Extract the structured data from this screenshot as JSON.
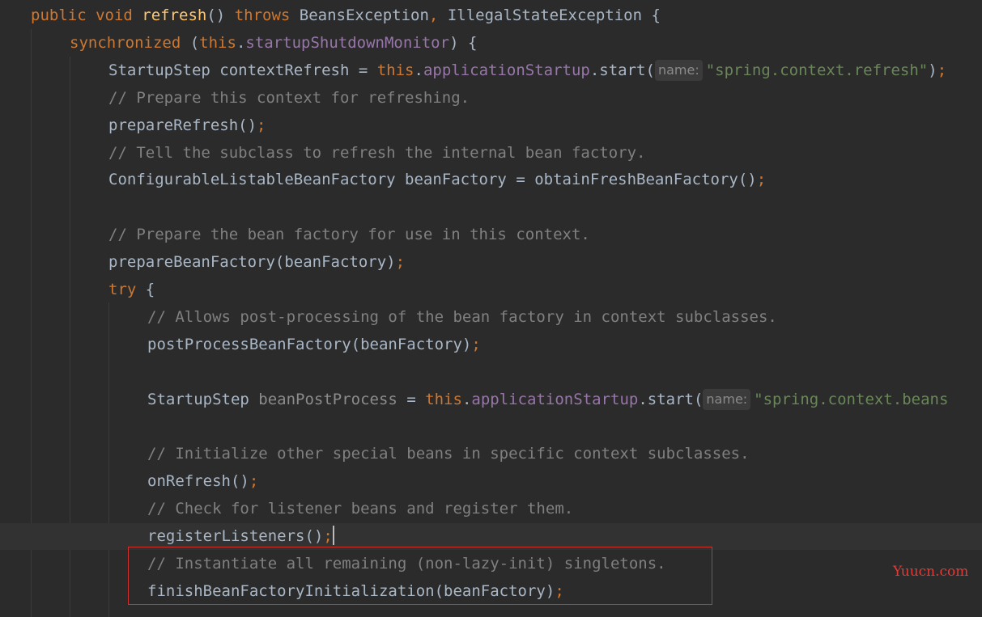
{
  "editor": {
    "lines": [
      {
        "indent": 38,
        "tokens": [
          {
            "t": "public ",
            "c": "kw"
          },
          {
            "t": "void ",
            "c": "kw"
          },
          {
            "t": "refresh",
            "c": "fn"
          },
          {
            "t": "() ",
            "c": "punc"
          },
          {
            "t": "throws ",
            "c": "kw"
          },
          {
            "t": "BeansException",
            "c": "cls"
          },
          {
            "t": ", ",
            "c": "semi"
          },
          {
            "t": "IllegalStateException ",
            "c": "cls"
          },
          {
            "t": "{",
            "c": "punc"
          }
        ]
      },
      {
        "indent": 86,
        "tokens": [
          {
            "t": "synchronized ",
            "c": "kw"
          },
          {
            "t": "(",
            "c": "punc"
          },
          {
            "t": "this",
            "c": "kw"
          },
          {
            "t": ".",
            "c": "punc"
          },
          {
            "t": "startupShutdownMonitor",
            "c": "fld"
          },
          {
            "t": ") {",
            "c": "punc"
          }
        ]
      },
      {
        "indent": 134,
        "tokens": [
          {
            "t": "StartupStep contextRefresh = ",
            "c": "cls"
          },
          {
            "t": "this",
            "c": "kw"
          },
          {
            "t": ".",
            "c": "punc"
          },
          {
            "t": "applicationStartup",
            "c": "fld"
          },
          {
            "t": ".start(",
            "c": "punc"
          },
          {
            "t": "name:",
            "c": "hint"
          },
          {
            "t": "\"spring.context.refresh\"",
            "c": "str"
          },
          {
            "t": ")",
            "c": "punc"
          },
          {
            "t": ";",
            "c": "semi"
          }
        ]
      },
      {
        "indent": 134,
        "tokens": [
          {
            "t": "// Prepare this context for refreshing.",
            "c": "cm"
          }
        ]
      },
      {
        "indent": 134,
        "tokens": [
          {
            "t": "prepareRefresh()",
            "c": "punc"
          },
          {
            "t": ";",
            "c": "semi"
          }
        ]
      },
      {
        "indent": 134,
        "tokens": [
          {
            "t": "// Tell the subclass to refresh the internal bean factory.",
            "c": "cm"
          }
        ]
      },
      {
        "indent": 134,
        "tokens": [
          {
            "t": "ConfigurableListableBeanFactory beanFactory = obtainFreshBeanFactory()",
            "c": "punc"
          },
          {
            "t": ";",
            "c": "semi"
          }
        ]
      },
      {
        "indent": 134,
        "tokens": []
      },
      {
        "indent": 134,
        "tokens": [
          {
            "t": "// Prepare the bean factory for use in this context.",
            "c": "cm"
          }
        ]
      },
      {
        "indent": 134,
        "tokens": [
          {
            "t": "prepareBeanFactory(beanFactory)",
            "c": "punc"
          },
          {
            "t": ";",
            "c": "semi"
          }
        ]
      },
      {
        "indent": 134,
        "tokens": [
          {
            "t": "try ",
            "c": "kw"
          },
          {
            "t": "{",
            "c": "punc"
          }
        ]
      },
      {
        "indent": 182,
        "tokens": [
          {
            "t": "// Allows post-processing of the bean factory in context subclasses.",
            "c": "cm"
          }
        ]
      },
      {
        "indent": 182,
        "tokens": [
          {
            "t": "postProcessBeanFactory(beanFactory)",
            "c": "punc"
          },
          {
            "t": ";",
            "c": "semi"
          }
        ]
      },
      {
        "indent": 182,
        "tokens": []
      },
      {
        "indent": 182,
        "tokens": [
          {
            "t": "StartupStep ",
            "c": "cls"
          },
          {
            "t": "beanPostProcess",
            "c": "unused"
          },
          {
            "t": " = ",
            "c": "punc"
          },
          {
            "t": "this",
            "c": "kw"
          },
          {
            "t": ".",
            "c": "punc"
          },
          {
            "t": "applicationStartup",
            "c": "fld"
          },
          {
            "t": ".start(",
            "c": "punc"
          },
          {
            "t": "name:",
            "c": "hint"
          },
          {
            "t": "\"spring.context.beans",
            "c": "str"
          }
        ]
      },
      {
        "indent": 182,
        "tokens": []
      },
      {
        "indent": 182,
        "tokens": [
          {
            "t": "// Initialize other special beans in specific context subclasses.",
            "c": "cm"
          }
        ]
      },
      {
        "indent": 182,
        "tokens": [
          {
            "t": "onRefresh()",
            "c": "punc"
          },
          {
            "t": ";",
            "c": "semi"
          }
        ]
      },
      {
        "indent": 182,
        "tokens": [
          {
            "t": "// Check for listener beans and register them.",
            "c": "cm"
          }
        ]
      },
      {
        "indent": 182,
        "current": true,
        "caret": true,
        "tokens": [
          {
            "t": "registerListeners()",
            "c": "punc"
          },
          {
            "t": ";",
            "c": "semi"
          }
        ]
      },
      {
        "indent": 182,
        "tokens": [
          {
            "t": "// Instantiate all remaining (non-lazy-init) singletons.",
            "c": "cm"
          }
        ]
      },
      {
        "indent": 182,
        "tokens": [
          {
            "t": "finishBeanFactoryInitialization(beanFactory)",
            "c": "punc"
          },
          {
            "t": ";",
            "c": "semi"
          }
        ]
      }
    ]
  },
  "watermark": "Yuucn.com",
  "colors": {
    "background": "#2b2b2b",
    "keyword": "#cc7832",
    "method_decl": "#ffc66d",
    "field": "#9876aa",
    "comment": "#808080",
    "string": "#6a8759",
    "default_text": "#a9b7c6",
    "highlight_box": "#d0312d",
    "watermark": "#e53935"
  }
}
